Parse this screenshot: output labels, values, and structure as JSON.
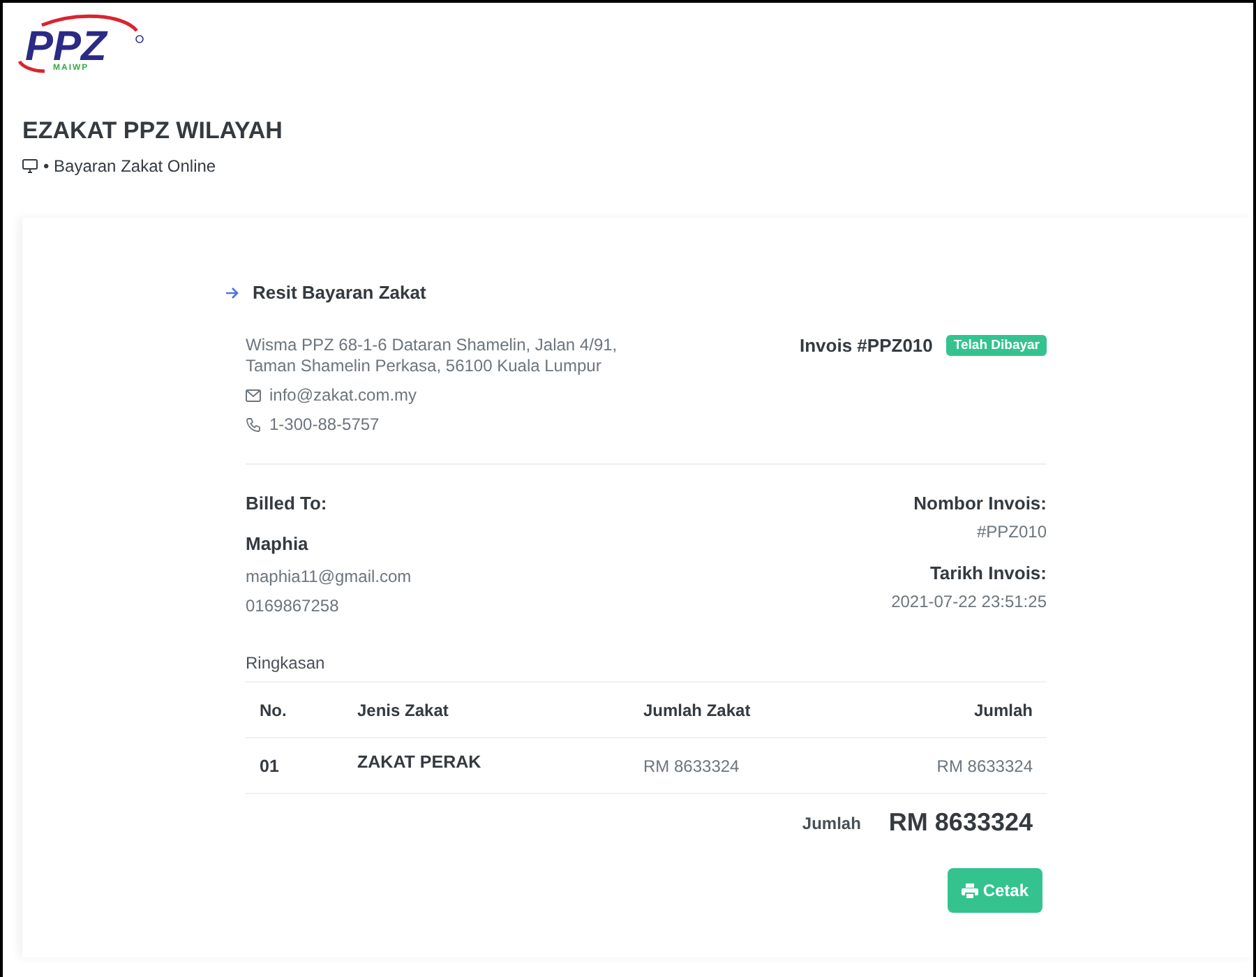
{
  "logo": {
    "text": "PPZ",
    "subtext": "MAIWP"
  },
  "header": {
    "title": "EZAKAT PPZ WILAYAH",
    "breadcrumb": "• Bayaran Zakat Online"
  },
  "receipt": {
    "heading": "Resit Bayaran Zakat",
    "address": [
      "Wisma PPZ 68-1-6 Dataran Shamelin, Jalan 4/91,",
      "Taman Shamelin Perkasa, 56100 Kuala Lumpur"
    ],
    "email": "info@zakat.com.my",
    "phone": "1-300-88-5757",
    "invoice_title": "Invois #PPZ010",
    "status": "Telah Dibayar",
    "billed_to": {
      "label": "Billed To:",
      "name": "Maphia",
      "email": "maphia11@gmail.com",
      "phone": "0169867258"
    },
    "invoice_number": {
      "label": "Nombor Invois:",
      "value": "#PPZ010"
    },
    "invoice_date": {
      "label": "Tarikh Invois:",
      "value": "2021-07-22 23:51:25"
    },
    "summary_title": "Ringkasan",
    "table": {
      "columns": [
        "No.",
        "Jenis Zakat",
        "Jumlah Zakat",
        "Jumlah"
      ],
      "rows": [
        [
          "01",
          "ZAKAT PERAK",
          "RM 8633324",
          "RM 8633324"
        ]
      ]
    },
    "total": {
      "label": "Jumlah",
      "value": "RM 8633324"
    },
    "print_button": "Cetak"
  }
}
